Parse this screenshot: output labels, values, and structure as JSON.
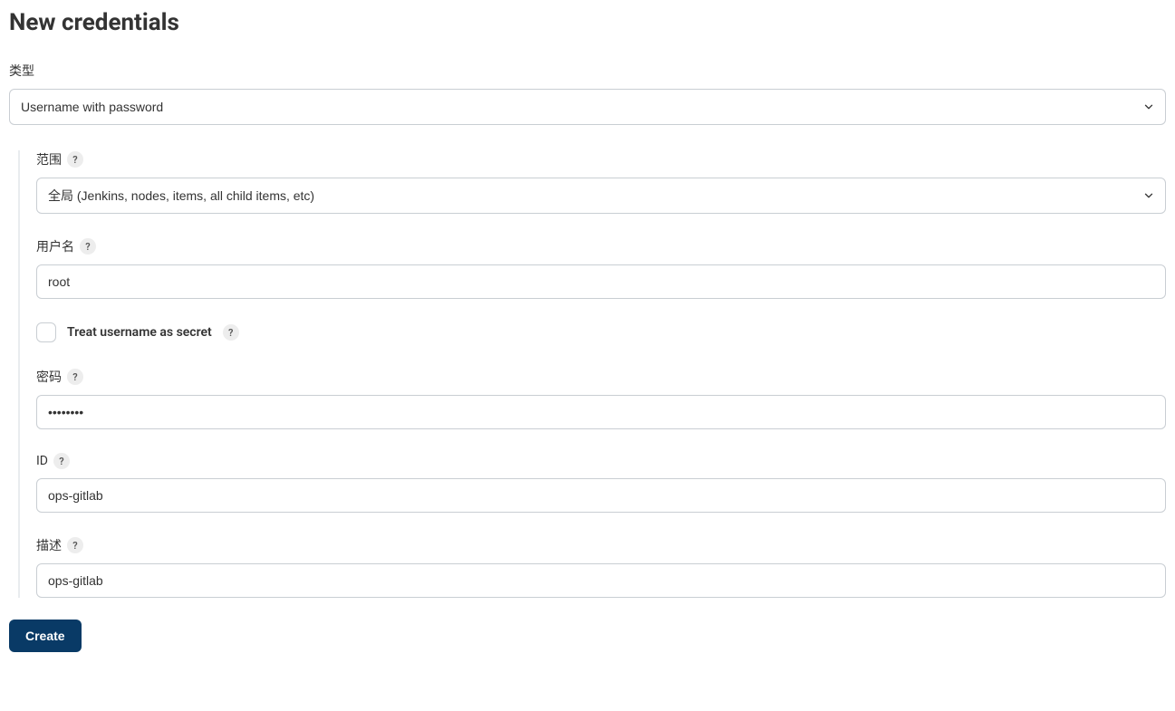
{
  "page": {
    "title": "New credentials"
  },
  "kind": {
    "label": "类型",
    "value": "Username with password"
  },
  "scope": {
    "label": "范围",
    "value": "全局 (Jenkins, nodes, items, all child items, etc)"
  },
  "username": {
    "label": "用户名",
    "value": "root"
  },
  "treat_secret": {
    "label": "Treat username as secret",
    "checked": false
  },
  "password": {
    "label": "密码",
    "value": "••••••••"
  },
  "id": {
    "label": "ID",
    "value": "ops-gitlab"
  },
  "description": {
    "label": "描述",
    "value": "ops-gitlab"
  },
  "buttons": {
    "create": "Create"
  },
  "help_glyph": "?"
}
